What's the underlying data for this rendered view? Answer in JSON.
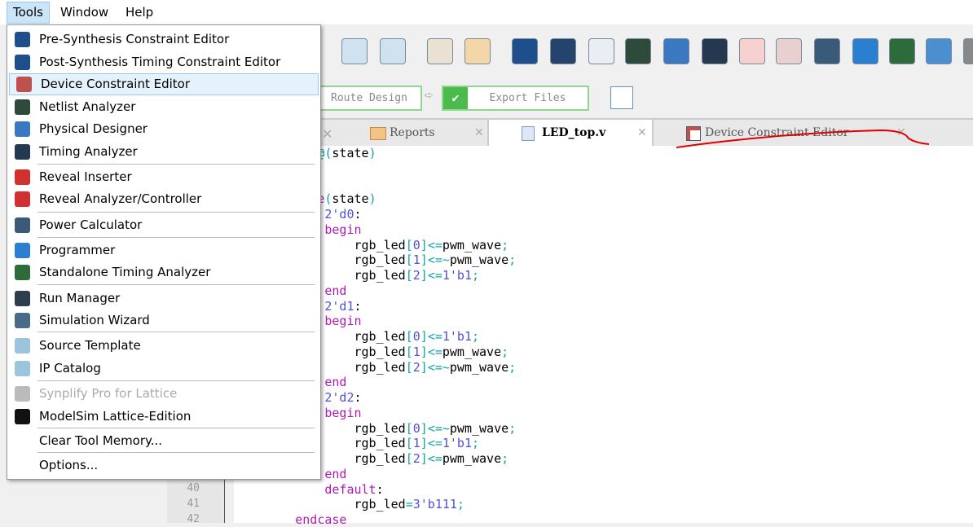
{
  "menubar": {
    "items": [
      "Tools",
      "Window",
      "Help"
    ]
  },
  "toolbar": {
    "icons": [
      "source-template-icon",
      "ip-catalog-icon",
      "home-icon",
      "reports-icon",
      "pre-synthesis-icon",
      "post-synthesis-icon",
      "device-constraint-icon",
      "netlist-analyzer-icon",
      "physical-designer-icon",
      "timing-analyzer-icon",
      "reveal-inserter-icon",
      "reveal-analyzer-icon",
      "power-calculator-icon",
      "programmer-icon",
      "standalone-timing-icon",
      "run-manager-icon",
      "overflow-icon"
    ]
  },
  "flow": {
    "route_design": "Route Design",
    "export_files": "Export Files"
  },
  "tabs": [
    {
      "label": "Reports"
    },
    {
      "label": "LED_top.v"
    },
    {
      "label": "Device Constraint Editor"
    }
  ],
  "editor": {
    "line_numbers": [
      "40",
      "41",
      "42"
    ],
    "lines": [
      "    always @(state)",
      "",
      "",
      "        case(state)",
      "            2'd0:",
      "            begin",
      "                rgb_led[0]<=pwm_wave;",
      "                rgb_led[1]<=~pwm_wave;",
      "                rgb_led[2]<=1'b1;",
      "            end",
      "            2'd1:",
      "            begin",
      "                rgb_led[0]<=1'b1;",
      "                rgb_led[1]<=pwm_wave;",
      "                rgb_led[2]<=~pwm_wave;",
      "            end",
      "            2'd2:",
      "            begin",
      "                rgb_led[0]<=~pwm_wave;",
      "                rgb_led[1]<=1'b1;",
      "                rgb_led[2]<=pwm_wave;",
      "            end",
      "            default:",
      "                rgb_led=3'b111;",
      "        endcase"
    ]
  },
  "menu": {
    "items": [
      {
        "label": "Pre-Synthesis Constraint Editor",
        "icon": "pre-synthesis-constraint-icon",
        "color": "#1f4e8c"
      },
      {
        "label": "Post-Synthesis Timing Constraint Editor",
        "icon": "post-synthesis-timing-icon",
        "color": "#1f4e8c"
      },
      {
        "label": "Device Constraint Editor",
        "icon": "device-constraint-icon",
        "color": "#c0504d",
        "highlighted": true
      },
      {
        "label": "Netlist Analyzer",
        "icon": "netlist-analyzer-icon",
        "color": "#2e4a3a"
      },
      {
        "label": "Physical Designer",
        "icon": "physical-designer-icon",
        "color": "#3a78c2"
      },
      {
        "label": "Timing Analyzer",
        "icon": "timing-analyzer-icon",
        "color": "#24394f"
      },
      {
        "label": "Reveal Inserter",
        "icon": "reveal-inserter-icon",
        "color": "#d03030"
      },
      {
        "label": "Reveal Analyzer/Controller",
        "icon": "reveal-analyzer-icon",
        "color": "#d03030"
      },
      {
        "label": "Power Calculator",
        "icon": "power-calculator-icon",
        "color": "#3a5a7a"
      },
      {
        "label": "Programmer",
        "icon": "programmer-icon",
        "color": "#2a7fd0"
      },
      {
        "label": "Standalone Timing Analyzer",
        "icon": "standalone-timing-icon",
        "color": "#2e6b3a"
      },
      {
        "label": "Run Manager",
        "icon": "run-manager-icon",
        "color": "#2e3e4f"
      },
      {
        "label": "Simulation Wizard",
        "icon": "simulation-wizard-icon",
        "color": "#4a6a8a"
      },
      {
        "label": "Source Template",
        "icon": "source-template-icon",
        "color": "#9cc4dc"
      },
      {
        "label": "IP Catalog",
        "icon": "ip-catalog-icon",
        "color": "#9cc4dc"
      },
      {
        "label": "Synplify Pro for Lattice",
        "icon": "synplify-icon",
        "color": "#bbbbbb",
        "disabled": true
      },
      {
        "label": "ModelSim Lattice-Edition",
        "icon": "modelsim-icon",
        "color": "#111111"
      },
      {
        "label": "Clear Tool Memory..."
      },
      {
        "label": "Options..."
      }
    ]
  },
  "colors": {
    "annotation": "#e00000",
    "highlight": "#cce4f7",
    "flow_border": "#8fd68f"
  }
}
